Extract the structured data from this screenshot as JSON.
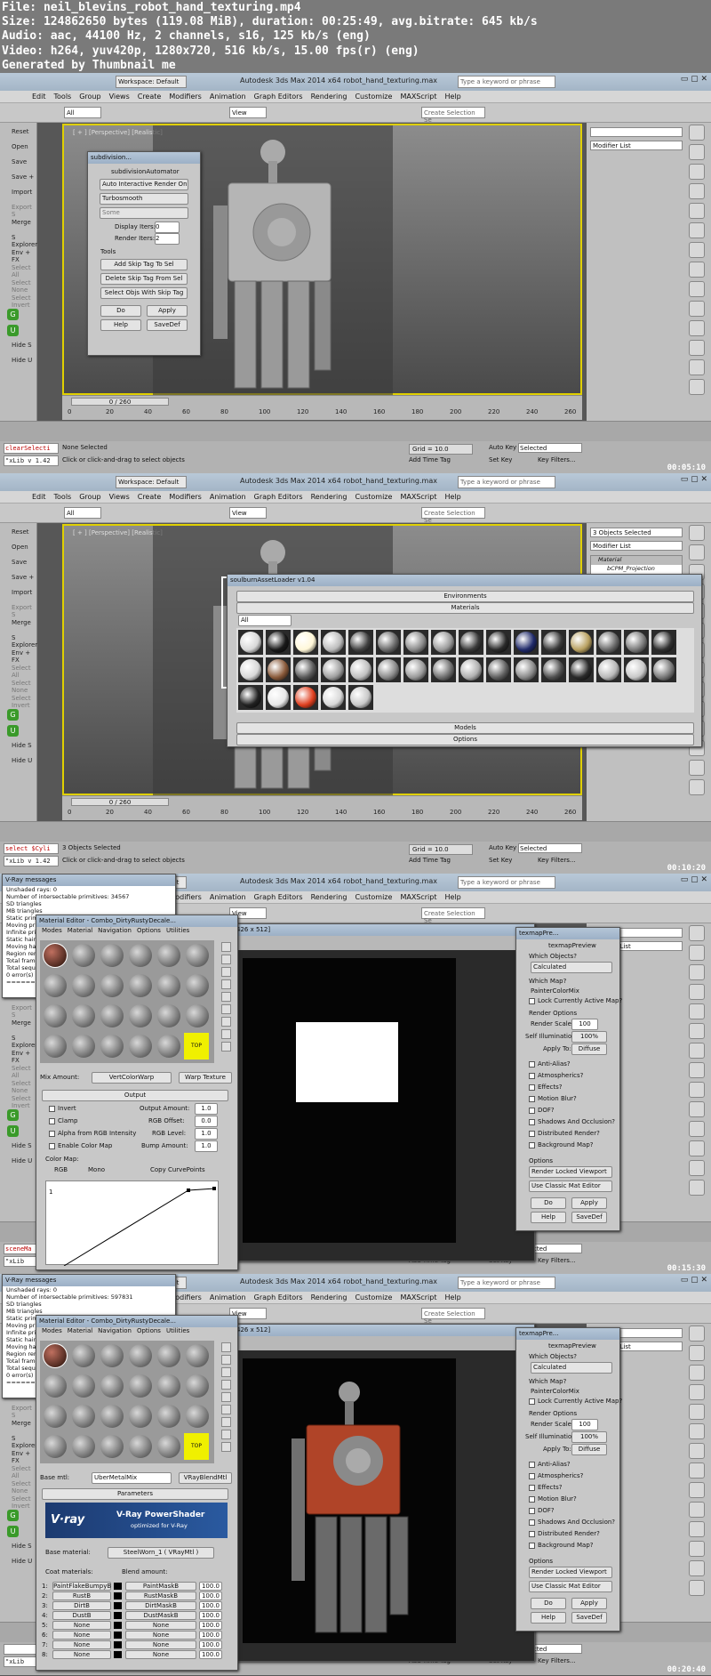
{
  "file_info": [
    "File: neil_blevins_robot_hand_texturing.mp4",
    "Size: 124862650 bytes (119.08 MiB), duration: 00:25:49, avg.bitrate: 645 kb/s",
    "Audio: aac, 44100 Hz, 2 channels, s16, 125 kb/s (eng)",
    "Video: h264, yuv420p, 1280x720, 516 kb/s, 15.00 fps(r) (eng)",
    "Generated by Thumbnail me"
  ],
  "app": {
    "workspace": "Workspace: Default",
    "title": "Autodesk 3ds Max 2014 x64     robot_hand_texturing.max",
    "search_placeholder": "Type a keyword or phrase",
    "menu": [
      "Edit",
      "Tools",
      "Group",
      "Views",
      "Create",
      "Modifiers",
      "Animation",
      "Graph Editors",
      "Rendering",
      "Customize",
      "MAXScript",
      "Help"
    ],
    "toolbar_all": "All",
    "toolbar_view": "View",
    "create_selection": "Create Selection Se",
    "left_panel": [
      "Reset",
      "Open",
      "Save",
      "Save +",
      "Import",
      "Export S",
      "Merge",
      "S Explorer",
      "Env + FX",
      "Select All",
      "Select None",
      "Select Invert"
    ],
    "left_panel_bottom": [
      "Hide S",
      "Hide U"
    ],
    "modifier_list": "Modifier List",
    "timeline": "0 / 260",
    "ticks": [
      "0",
      "20",
      "40",
      "60",
      "80",
      "100",
      "120",
      "140",
      "160",
      "180",
      "200",
      "220",
      "240",
      "260"
    ],
    "grid": "Grid = 10.0",
    "add_time_tag": "Add Time Tag",
    "auto_key": "Auto Key",
    "set_key": "Set Key",
    "selected": "Selected",
    "key_filters": "Key Filters...",
    "prompt": "Click or click-and-drag to select objects"
  },
  "frames": [
    {
      "viewport_label": "[ + ] [Perspective] [Realistic]",
      "script_line1": "clearSelecti",
      "script_line2": "\"xLib v 1.42",
      "status": "None Selected",
      "timestamp": "00:05:10"
    },
    {
      "viewport_label": "[ + ] [Perspective] [Realistic]",
      "script_line1": "select $Cyli",
      "script_line2": "\"xLib v 1.42",
      "status": "3 Objects Selected",
      "selection_count": "3 Objects Selected",
      "stack": [
        "Material",
        "bCPM_Projection",
        "bBPM__Front",
        "bBPM__Right",
        "bBPM__Top"
      ],
      "timestamp": "00:10:20"
    },
    {
      "script_line1": "sceneMa",
      "script_line2": "\"xLib",
      "timestamp": "00:15:30"
    },
    {
      "script_line1": "",
      "script_line2": "\"xLib",
      "timestamp": "00:20:40"
    }
  ],
  "subdiv_dialog": {
    "title": "subdivision...",
    "header": "subdivisionAutomator",
    "dropdown1": "Auto Interactive Render On",
    "dropdown2": "Turbosmooth",
    "dropdown3": "Some",
    "display_iters_label": "Display Iters:",
    "display_iters": "0",
    "render_iters_label": "Render Iters:",
    "render_iters": "2",
    "tools_label": "Tools",
    "buttons": [
      "Add Skip Tag To Sel",
      "Delete Skip Tag From Sel",
      "Select Objs With Skip Tag"
    ],
    "do": "Do",
    "apply": "Apply",
    "help": "Help",
    "savedef": "SaveDef"
  },
  "asset_loader": {
    "title": "soulburnAssetLoader v1.04",
    "environments": "Environments",
    "materials": "Materials",
    "filter": "All",
    "models": "Models",
    "options": "Options",
    "tiles": [
      "#d8d8d8",
      "#1a1a1a",
      "#fff7d8",
      "#bcbcbc",
      "#404040",
      "#6a6a6a",
      "#8a8a8a",
      "#9a9a9a",
      "#3a3a3a",
      "#2a2a2a",
      "#202a6a",
      "#3a3a3a",
      "#b8a060",
      "#6a6a6a",
      "#7a7a7a",
      "#303030",
      "#d8d8d8",
      "#8a5a3a",
      "#5a5a5a",
      "#a0a0a0",
      "#c0c0c0",
      "#8a8a8a",
      "#9a9a9a",
      "#707070",
      "#b0b0b0",
      "#606060",
      "#8a8a8a",
      "#505050",
      "#2a2a2a",
      "#b8b8b8",
      "#c8c8c8",
      "#7a7a7a",
      "#222222",
      "#e8e8e8",
      "#e04020",
      "#d8d8d8",
      "#c8c8c8"
    ]
  },
  "vray_messages": {
    "title": "V-Ray messages",
    "lines_a": [
      "Unshaded rays: 0",
      "Number of intersectable primitives: 34567",
      "SD triangles",
      "MB triangles",
      "Static primitives",
      "Moving primitives",
      "Infinite primitives",
      "Static hair",
      "Moving hair",
      "Region rendering",
      "Total frame",
      "Total sequence",
      "0 error(s)",
      "======="
    ],
    "lines_b": [
      "Unshaded rays: 0",
      "Number of intersectable primitives: 597831",
      "SD triangles",
      "MB triangles",
      "Static primitives",
      "Moving primitives",
      "Infinite primitives",
      "Static hair",
      "Moving hair",
      "Region rendering",
      "Total frame",
      "Total sequence",
      "0 error(s)",
      "======="
    ]
  },
  "mat_editor": {
    "title": "Material Editor - Combo_DirtyRustyDecale...",
    "menu": [
      "Modes",
      "Material",
      "Navigation",
      "Options",
      "Utilities"
    ],
    "top_label": "TOP",
    "mix_amount_label": "Mix Amount:",
    "mix_amount": "VertColorWarp",
    "warp_texture": "Warp Texture",
    "output_header": "Output",
    "invert": "Invert",
    "clamp": "Clamp",
    "alpha_rgb": "Alpha from RGB Intensity",
    "enable_color_map": "Enable Color Map",
    "output_amount_label": "Output Amount:",
    "output_amount": "1.0",
    "rgb_offset_label": "RGB Offset:",
    "rgb_offset": "0.0",
    "rgb_level_label": "RGB Level:",
    "rgb_level": "1.0",
    "bump_amount_label": "Bump Amount:",
    "bump_amount": "1.0",
    "color_map": "Color Map:",
    "rgb": "RGB",
    "mono": "Mono",
    "copy_curve": "Copy CurvePoints",
    "curve_value": "1",
    "base_mtl_label": "Base mtl:",
    "base_mtl": "UberMetalMix",
    "blend_type": "VRayBlendMtl",
    "params": "Parameters",
    "vray_logo": "V·ray",
    "vray_title": "V-Ray PowerShader",
    "vray_sub": "optimized for V-Ray",
    "base_material_label": "Base material:",
    "base_material": "SteelWorn_1  ( VRayMtl )",
    "coat_label": "Coat materials:",
    "blend_label": "Blend amount:",
    "coat_rows": [
      {
        "n": "1:",
        "coat": "PaintFlakeBumpyB",
        "blend": "PaintMaskB",
        "amt": "100.0"
      },
      {
        "n": "2:",
        "coat": "RustB",
        "blend": "RustMaskB",
        "amt": "100.0"
      },
      {
        "n": "3:",
        "coat": "DirtB",
        "blend": "DirtMaskB",
        "amt": "100.0"
      },
      {
        "n": "4:",
        "coat": "DustB",
        "blend": "DustMaskB",
        "amt": "100.0"
      },
      {
        "n": "5:",
        "coat": "None",
        "blend": "None",
        "amt": "100.0"
      },
      {
        "n": "6:",
        "coat": "None",
        "blend": "None",
        "amt": "100.0"
      },
      {
        "n": "7:",
        "coat": "None",
        "blend": "None",
        "amt": "100.0"
      },
      {
        "n": "8:",
        "coat": "None",
        "blend": "None",
        "amt": "100.0"
      }
    ]
  },
  "render_window": {
    "title": "426 x 512]"
  },
  "texmap_preview": {
    "title": "texmapPre...",
    "header": "texmapPreview",
    "which_objects": "Which Objects?",
    "calculated": "Calculated",
    "which_map": "Which Map?",
    "painter_mix": "PainterColorMix",
    "lock_map": "Lock Currently Active Map?",
    "render_options": "Render Options",
    "render_scale_label": "Render Scale:",
    "render_scale": "100",
    "self_illum_label": "Self Illumination:",
    "self_illum": "100%",
    "apply_to_label": "Apply To:",
    "apply_to": "Diffuse",
    "checks": [
      "Anti-Alias?",
      "Atmospherics?",
      "Effects?",
      "Motion Blur?",
      "DOF?",
      "Shadows And Occlusion?",
      "Distributed Render?",
      "Background Map?"
    ],
    "options": "Options",
    "viewport_opt": "Render Locked Viewport",
    "classic_opt": "Use Classic Mat Editor",
    "do": "Do",
    "apply": "Apply",
    "help": "Help",
    "savedef": "SaveDef"
  }
}
